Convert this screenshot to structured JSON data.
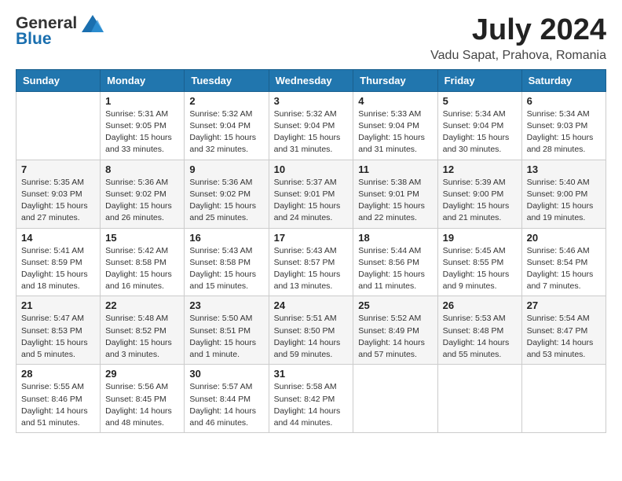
{
  "header": {
    "logo_general": "General",
    "logo_blue": "Blue",
    "title": "July 2024",
    "subtitle": "Vadu Sapat, Prahova, Romania"
  },
  "days_of_week": [
    "Sunday",
    "Monday",
    "Tuesday",
    "Wednesday",
    "Thursday",
    "Friday",
    "Saturday"
  ],
  "weeks": [
    [
      {
        "day": "",
        "info": ""
      },
      {
        "day": "1",
        "info": "Sunrise: 5:31 AM\nSunset: 9:05 PM\nDaylight: 15 hours\nand 33 minutes."
      },
      {
        "day": "2",
        "info": "Sunrise: 5:32 AM\nSunset: 9:04 PM\nDaylight: 15 hours\nand 32 minutes."
      },
      {
        "day": "3",
        "info": "Sunrise: 5:32 AM\nSunset: 9:04 PM\nDaylight: 15 hours\nand 31 minutes."
      },
      {
        "day": "4",
        "info": "Sunrise: 5:33 AM\nSunset: 9:04 PM\nDaylight: 15 hours\nand 31 minutes."
      },
      {
        "day": "5",
        "info": "Sunrise: 5:34 AM\nSunset: 9:04 PM\nDaylight: 15 hours\nand 30 minutes."
      },
      {
        "day": "6",
        "info": "Sunrise: 5:34 AM\nSunset: 9:03 PM\nDaylight: 15 hours\nand 28 minutes."
      }
    ],
    [
      {
        "day": "7",
        "info": "Sunrise: 5:35 AM\nSunset: 9:03 PM\nDaylight: 15 hours\nand 27 minutes."
      },
      {
        "day": "8",
        "info": "Sunrise: 5:36 AM\nSunset: 9:02 PM\nDaylight: 15 hours\nand 26 minutes."
      },
      {
        "day": "9",
        "info": "Sunrise: 5:36 AM\nSunset: 9:02 PM\nDaylight: 15 hours\nand 25 minutes."
      },
      {
        "day": "10",
        "info": "Sunrise: 5:37 AM\nSunset: 9:01 PM\nDaylight: 15 hours\nand 24 minutes."
      },
      {
        "day": "11",
        "info": "Sunrise: 5:38 AM\nSunset: 9:01 PM\nDaylight: 15 hours\nand 22 minutes."
      },
      {
        "day": "12",
        "info": "Sunrise: 5:39 AM\nSunset: 9:00 PM\nDaylight: 15 hours\nand 21 minutes."
      },
      {
        "day": "13",
        "info": "Sunrise: 5:40 AM\nSunset: 9:00 PM\nDaylight: 15 hours\nand 19 minutes."
      }
    ],
    [
      {
        "day": "14",
        "info": "Sunrise: 5:41 AM\nSunset: 8:59 PM\nDaylight: 15 hours\nand 18 minutes."
      },
      {
        "day": "15",
        "info": "Sunrise: 5:42 AM\nSunset: 8:58 PM\nDaylight: 15 hours\nand 16 minutes."
      },
      {
        "day": "16",
        "info": "Sunrise: 5:43 AM\nSunset: 8:58 PM\nDaylight: 15 hours\nand 15 minutes."
      },
      {
        "day": "17",
        "info": "Sunrise: 5:43 AM\nSunset: 8:57 PM\nDaylight: 15 hours\nand 13 minutes."
      },
      {
        "day": "18",
        "info": "Sunrise: 5:44 AM\nSunset: 8:56 PM\nDaylight: 15 hours\nand 11 minutes."
      },
      {
        "day": "19",
        "info": "Sunrise: 5:45 AM\nSunset: 8:55 PM\nDaylight: 15 hours\nand 9 minutes."
      },
      {
        "day": "20",
        "info": "Sunrise: 5:46 AM\nSunset: 8:54 PM\nDaylight: 15 hours\nand 7 minutes."
      }
    ],
    [
      {
        "day": "21",
        "info": "Sunrise: 5:47 AM\nSunset: 8:53 PM\nDaylight: 15 hours\nand 5 minutes."
      },
      {
        "day": "22",
        "info": "Sunrise: 5:48 AM\nSunset: 8:52 PM\nDaylight: 15 hours\nand 3 minutes."
      },
      {
        "day": "23",
        "info": "Sunrise: 5:50 AM\nSunset: 8:51 PM\nDaylight: 15 hours\nand 1 minute."
      },
      {
        "day": "24",
        "info": "Sunrise: 5:51 AM\nSunset: 8:50 PM\nDaylight: 14 hours\nand 59 minutes."
      },
      {
        "day": "25",
        "info": "Sunrise: 5:52 AM\nSunset: 8:49 PM\nDaylight: 14 hours\nand 57 minutes."
      },
      {
        "day": "26",
        "info": "Sunrise: 5:53 AM\nSunset: 8:48 PM\nDaylight: 14 hours\nand 55 minutes."
      },
      {
        "day": "27",
        "info": "Sunrise: 5:54 AM\nSunset: 8:47 PM\nDaylight: 14 hours\nand 53 minutes."
      }
    ],
    [
      {
        "day": "28",
        "info": "Sunrise: 5:55 AM\nSunset: 8:46 PM\nDaylight: 14 hours\nand 51 minutes."
      },
      {
        "day": "29",
        "info": "Sunrise: 5:56 AM\nSunset: 8:45 PM\nDaylight: 14 hours\nand 48 minutes."
      },
      {
        "day": "30",
        "info": "Sunrise: 5:57 AM\nSunset: 8:44 PM\nDaylight: 14 hours\nand 46 minutes."
      },
      {
        "day": "31",
        "info": "Sunrise: 5:58 AM\nSunset: 8:42 PM\nDaylight: 14 hours\nand 44 minutes."
      },
      {
        "day": "",
        "info": ""
      },
      {
        "day": "",
        "info": ""
      },
      {
        "day": "",
        "info": ""
      }
    ]
  ]
}
